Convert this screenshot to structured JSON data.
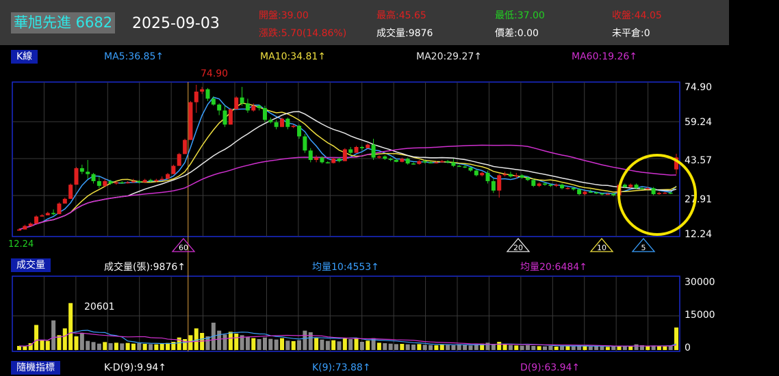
{
  "header": {
    "stock_name": "華旭先進 6682",
    "date": "2025-09-03",
    "open": "開盤:39.00",
    "high": "最高:45.65",
    "low": "最低:37.00",
    "close": "收盤:44.05",
    "change": "漲跌:5.70(14.86%)",
    "volume": "成交量:9876",
    "price_diff": "價差:0.00",
    "unclosed": "未平倉:0",
    "colors": {
      "up": "#e02020",
      "down": "#22d022",
      "flat": "#ffffff",
      "name": "#2fe6e6"
    }
  },
  "kline": {
    "label": "K線",
    "ma5": "MA5:36.85↑",
    "ma10": "MA10:34.81↑",
    "ma20": "MA20:29.27↑",
    "ma60": "MA60:19.26↑",
    "colors": {
      "ma5": "#3aa0ff",
      "ma10": "#f0e040",
      "ma20": "#e8e8e8",
      "ma60": "#d030d0"
    }
  },
  "volume_panel": {
    "label": "成交量",
    "vol": "成交量(張):9876↑",
    "avg10": "均量10:4553↑",
    "avg20": "均量20:6484↑"
  },
  "kd_panel": {
    "label": "隨機指標",
    "kd": "K-D(9):9.94↑",
    "k": "K(9):73.88↑",
    "d": "D(9):63.94↑"
  },
  "chart_data": {
    "type": "candlestick",
    "price_ticks": [
      "74.90",
      "59.24",
      "43.57",
      "27.91",
      "12.24"
    ],
    "volume_ticks": [
      "30000",
      "15000",
      "0"
    ],
    "max_label": "74.90",
    "min_label": "12.24",
    "peak_volume_label": "20601",
    "ylim": [
      12.24,
      74.9
    ],
    "volume_ylim": [
      0,
      30000
    ],
    "markers": [
      "60",
      "20",
      "10",
      "5"
    ],
    "candles": [
      [
        13,
        13,
        14,
        13.5
      ],
      [
        13.5,
        13.5,
        15.5,
        15
      ],
      [
        15,
        15,
        16.5,
        16
      ],
      [
        16,
        16,
        19.5,
        19
      ],
      [
        19,
        19,
        20,
        19.5
      ],
      [
        19.5,
        19.5,
        21,
        20.5
      ],
      [
        20.5,
        19.5,
        22,
        20
      ],
      [
        20,
        20,
        25,
        24.5
      ],
      [
        24.5,
        24.5,
        27,
        26.5
      ],
      [
        26.5,
        26.5,
        33,
        32.5
      ],
      [
        32.5,
        32.5,
        40,
        39.5
      ],
      [
        39.5,
        37,
        41,
        38
      ],
      [
        38,
        35,
        43,
        37
      ],
      [
        37,
        33,
        37.5,
        34
      ],
      [
        34,
        31,
        36,
        32
      ],
      [
        32,
        31.5,
        35,
        34
      ],
      [
        34,
        32.5,
        34.5,
        33
      ],
      [
        33,
        32.5,
        34,
        33.5
      ],
      [
        33.5,
        33,
        34,
        33.2
      ],
      [
        33.2,
        33,
        34,
        33.5
      ],
      [
        33.5,
        33.2,
        35,
        34
      ],
      [
        34,
        33,
        34.5,
        33.5
      ],
      [
        33.5,
        33.5,
        35,
        34.5
      ],
      [
        34.5,
        33.5,
        35,
        34
      ],
      [
        34,
        33.5,
        35,
        34.5
      ],
      [
        34.5,
        34.5,
        36,
        35
      ],
      [
        35,
        35,
        37.5,
        37
      ],
      [
        37,
        37,
        41,
        40.5
      ],
      [
        40.5,
        40.5,
        46,
        45.5
      ],
      [
        45.5,
        45.5,
        52,
        51.5
      ],
      [
        51.5,
        51.5,
        68,
        67.5
      ],
      [
        67.5,
        63,
        74.9,
        72
      ],
      [
        72,
        71,
        74,
        73
      ],
      [
        73,
        68,
        73.5,
        69
      ],
      [
        69,
        66,
        70,
        66.5
      ],
      [
        66.5,
        62,
        67,
        64
      ],
      [
        64,
        57,
        66,
        58
      ],
      [
        58,
        58,
        65,
        64.5
      ],
      [
        64.5,
        64.5,
        70,
        69.5
      ],
      [
        69.5,
        66,
        74,
        67
      ],
      [
        67,
        63,
        69,
        64
      ],
      [
        64,
        63.5,
        67,
        66
      ],
      [
        66,
        64,
        66.5,
        65
      ],
      [
        65,
        59,
        66,
        60
      ],
      [
        60,
        58.5,
        61,
        59
      ],
      [
        59,
        56,
        60,
        57
      ],
      [
        57,
        57,
        61,
        60.5
      ],
      [
        60.5,
        56,
        61,
        57
      ],
      [
        57,
        56.5,
        58,
        57.5
      ],
      [
        57.5,
        52,
        58,
        53
      ],
      [
        53,
        46,
        54,
        47
      ],
      [
        47,
        42,
        48,
        43
      ],
      [
        43,
        42,
        45,
        44
      ],
      [
        44,
        41.5,
        44.5,
        42
      ],
      [
        42,
        41.5,
        42.5,
        41.7
      ],
      [
        41.7,
        41.5,
        44,
        43.5
      ],
      [
        43.5,
        42,
        44,
        42.5
      ],
      [
        42.5,
        42.5,
        48,
        47.5
      ],
      [
        47.5,
        45,
        48.5,
        46
      ],
      [
        46,
        46,
        49,
        48.5
      ],
      [
        48.5,
        47,
        49,
        48
      ],
      [
        48,
        48,
        50,
        49.5
      ],
      [
        49.5,
        43,
        52,
        44
      ],
      [
        44,
        43.5,
        45,
        44.5
      ],
      [
        44.5,
        43,
        45,
        43.5
      ],
      [
        43.5,
        42.5,
        44,
        43
      ],
      [
        43,
        42,
        43.5,
        42.2
      ],
      [
        42.2,
        42,
        44,
        43.5
      ],
      [
        43.5,
        41,
        44,
        41.5
      ],
      [
        41.5,
        41,
        42,
        41.3
      ],
      [
        41.3,
        41,
        43,
        42.5
      ],
      [
        42.5,
        41.5,
        43,
        42
      ],
      [
        42,
        41.5,
        42.5,
        41.8
      ],
      [
        41.8,
        41.5,
        42.5,
        42
      ],
      [
        42,
        41.8,
        43,
        42.5
      ],
      [
        42.5,
        41.5,
        43,
        42
      ],
      [
        42,
        40,
        43.5,
        40.5
      ],
      [
        40.5,
        40,
        41,
        40.2
      ],
      [
        40.2,
        39.5,
        41,
        39.8
      ],
      [
        39.8,
        38,
        40,
        38.5
      ],
      [
        38.5,
        36,
        39,
        36.5
      ],
      [
        36.5,
        36,
        38,
        37.5
      ],
      [
        37.5,
        33,
        38.5,
        34
      ],
      [
        34,
        29,
        35,
        30
      ],
      [
        30,
        27,
        37,
        36.5
      ],
      [
        36.5,
        36,
        38,
        37
      ],
      [
        37,
        35.5,
        38,
        36
      ],
      [
        36,
        35,
        37.5,
        36.5
      ],
      [
        36.5,
        35,
        37,
        35.5
      ],
      [
        35.5,
        34,
        36,
        34.5
      ],
      [
        34.5,
        31.5,
        35,
        32
      ],
      [
        32,
        31.5,
        33.5,
        33
      ],
      [
        33,
        32,
        33.5,
        32.5
      ],
      [
        32.5,
        31.5,
        33,
        32
      ],
      [
        32,
        31.5,
        33,
        32.5
      ],
      [
        32.5,
        30.5,
        33,
        31
      ],
      [
        31,
        30.5,
        31.5,
        31.1
      ],
      [
        31.1,
        30,
        31.5,
        30.5
      ],
      [
        30.5,
        28,
        31,
        28.5
      ],
      [
        28.5,
        28,
        30,
        29.5
      ],
      [
        29.5,
        29,
        30.5,
        29.2
      ],
      [
        29.2,
        28.5,
        29.5,
        28.8
      ],
      [
        28.8,
        28,
        29,
        28.5
      ],
      [
        28.5,
        28.2,
        29,
        28.6
      ],
      [
        28.6,
        27.5,
        29,
        28
      ],
      [
        28,
        27.5,
        33,
        32.5
      ],
      [
        32.5,
        31,
        33,
        31.5
      ],
      [
        31.5,
        31,
        33,
        32.5
      ],
      [
        32.5,
        30.5,
        33,
        31
      ],
      [
        31,
        30.5,
        31.5,
        30.8
      ],
      [
        30.8,
        30.5,
        31.5,
        31
      ],
      [
        31,
        28,
        31.5,
        28.5
      ],
      [
        28.5,
        28.2,
        29.5,
        29
      ],
      [
        29,
        28.8,
        29.5,
        29.1
      ],
      [
        29.1,
        28.5,
        29.5,
        28.8
      ],
      [
        39,
        37,
        45.65,
        44.05
      ]
    ],
    "volumes": [
      1800,
      1600,
      3000,
      11000,
      4500,
      4000,
      13000,
      6500,
      9500,
      20601,
      6000,
      7500,
      4000,
      3500,
      2800,
      3500,
      3000,
      3200,
      2900,
      3100,
      2800,
      3000,
      2700,
      2600,
      2500,
      2800,
      3100,
      3600,
      5500,
      4800,
      6500,
      9500,
      7500,
      6000,
      12000,
      8500,
      6800,
      8000,
      7200,
      6500,
      5800,
      5200,
      4800,
      5500,
      4900,
      4600,
      5200,
      4100,
      3900,
      4300,
      8500,
      7800,
      5500,
      4600,
      4000,
      4300,
      3800,
      5200,
      4800,
      5000,
      3600,
      4100,
      5200,
      3200,
      3000,
      2800,
      2600,
      2700,
      2500,
      2400,
      2600,
      2300,
      2200,
      2100,
      2400,
      2200,
      2100,
      2600,
      2300,
      2000,
      2500,
      2800,
      3200,
      2700,
      3600,
      2400,
      2200,
      2000,
      1900,
      2100,
      1800,
      1700,
      1600,
      1800,
      1500,
      1700,
      1900,
      1600,
      2200,
      1800,
      1500,
      1700,
      1600,
      1400,
      1500,
      1700,
      1900,
      1600,
      2500,
      2100,
      1800,
      2000,
      1700,
      1600,
      1800,
      9876
    ]
  }
}
